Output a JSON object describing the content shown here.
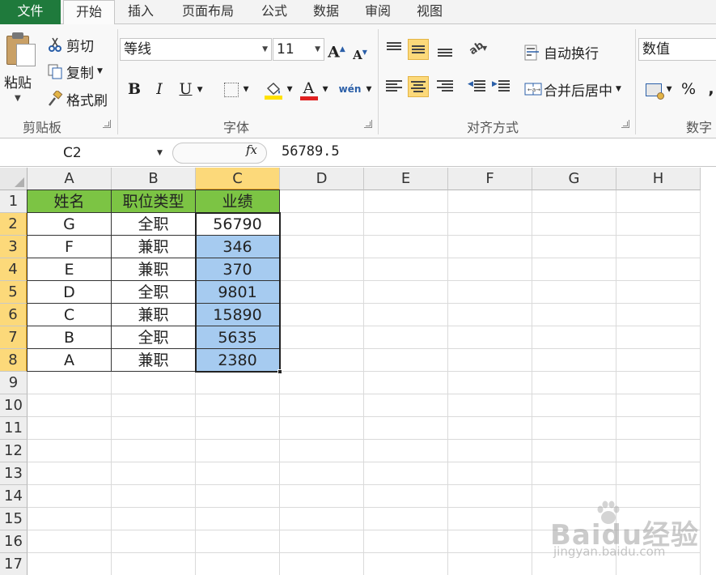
{
  "tabs": [
    "文件",
    "开始",
    "插入",
    "页面布局",
    "公式",
    "数据",
    "审阅",
    "视图"
  ],
  "active_tab": "开始",
  "ribbon": {
    "clipboard": {
      "paste": "粘贴",
      "cut": "剪切",
      "copy": "复制",
      "format_painter": "格式刷",
      "group_label": "剪贴板"
    },
    "font": {
      "font_name": "等线",
      "font_size": "11",
      "bold": "B",
      "italic": "I",
      "underline": "U",
      "font_color_glyph": "A",
      "grow_glyph": "A",
      "shrink_glyph": "A",
      "phonetic_glyph": "wén",
      "group_label": "字体",
      "font_color": "#e02020",
      "fill_color": "#ffe100"
    },
    "alignment": {
      "wrap_text": "自动换行",
      "merge_center": "合并后居中",
      "group_label": "对齐方式"
    },
    "number": {
      "format": "数值",
      "percent": "%",
      "comma": ",",
      "group_label": "数字"
    }
  },
  "formula_bar": {
    "name_box": "C2",
    "fx": "fx",
    "value": "56789.5"
  },
  "columns": [
    "A",
    "B",
    "C",
    "D",
    "E",
    "F",
    "G",
    "H"
  ],
  "rows": [
    "1",
    "2",
    "3",
    "4",
    "5",
    "6",
    "7",
    "8",
    "9",
    "10",
    "11",
    "12",
    "13",
    "14",
    "15",
    "16",
    "17"
  ],
  "selected_column": "C",
  "table": {
    "headers": [
      "姓名",
      "职位类型",
      "业绩"
    ],
    "rows": [
      [
        "G",
        "全职",
        "56790"
      ],
      [
        "F",
        "兼职",
        "346"
      ],
      [
        "E",
        "兼职",
        "370"
      ],
      [
        "D",
        "全职",
        "9801"
      ],
      [
        "C",
        "兼职",
        "15890"
      ],
      [
        "B",
        "全职",
        "5635"
      ],
      [
        "A",
        "兼职",
        "2380"
      ]
    ],
    "header_color": "#7cc444",
    "highlight_color": "#a6cbf0"
  },
  "watermark": {
    "brand": "Baidu经验",
    "url": "jingyan.baidu.com"
  }
}
